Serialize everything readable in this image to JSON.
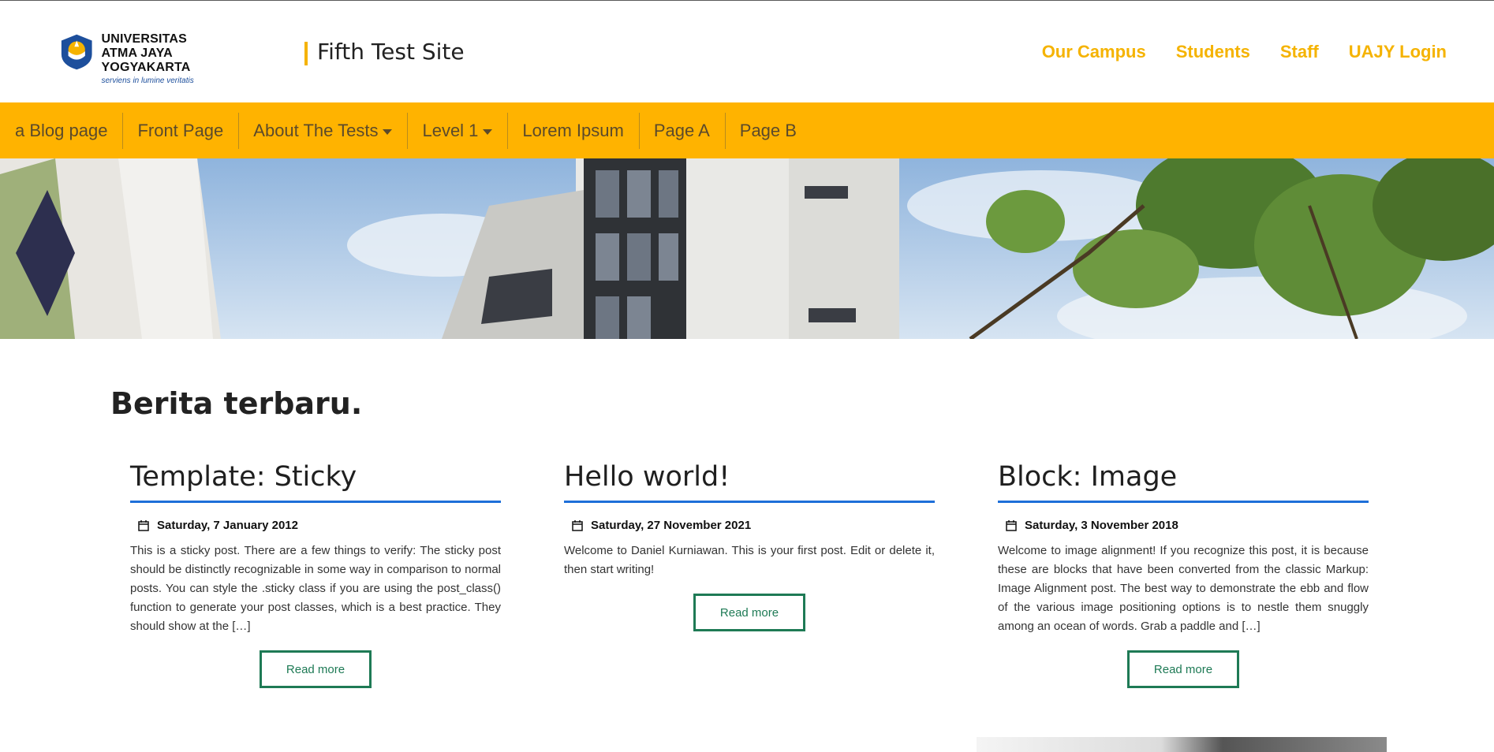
{
  "header": {
    "logo": {
      "line1": "UNIVERSITAS",
      "line2": "ATMA JAYA YOGYAKARTA",
      "tagline": "serviens in lumine veritatis"
    },
    "site_title": "Fifth Test Site",
    "nav": [
      {
        "label": "Our Campus"
      },
      {
        "label": "Students"
      },
      {
        "label": "Staff"
      },
      {
        "label": "UAJY Login"
      }
    ]
  },
  "menu": {
    "items": [
      {
        "label": "a Blog page"
      },
      {
        "label": "Front Page"
      },
      {
        "label": "About The Tests"
      },
      {
        "label": "Level 1"
      },
      {
        "label": "Lorem Ipsum"
      },
      {
        "label": "Page A"
      },
      {
        "label": "Page B"
      }
    ]
  },
  "main": {
    "section_title": "Berita terbaru.",
    "posts": [
      {
        "title": "Template: Sticky",
        "date": "Saturday, 7 January 2012",
        "excerpt": "This is a sticky post. There are a few things to verify: The sticky post should be distinctly recognizable in some way in comparison to normal posts. You can style the .sticky class if you are using the post_class() function to generate your post classes, which is a best practice. They should show at the […]",
        "read_more": "Read more"
      },
      {
        "title": "Hello world!",
        "date": "Saturday, 27 November 2021",
        "excerpt": "Welcome to Daniel Kurniawan. This is your first post. Edit or delete it, then start writing!",
        "read_more": "Read more"
      },
      {
        "title": "Block: Image",
        "date": "Saturday, 3 November 2018",
        "excerpt": "Welcome to image alignment! If you recognize this post, it is because these are blocks that have been converted from the classic Markup: Image Alignment post. The best way to demonstrate the ebb and flow of the various image positioning options is to nestle them snuggly among an ocean of words. Grab a paddle and […]",
        "read_more": "Read more"
      }
    ]
  },
  "colors": {
    "accent_yellow": "#ffb300",
    "link_yellow": "#f5b301",
    "title_underline": "#1e6fd9",
    "button_green": "#1e7a55"
  },
  "icons": {
    "date": "calendar-icon"
  }
}
